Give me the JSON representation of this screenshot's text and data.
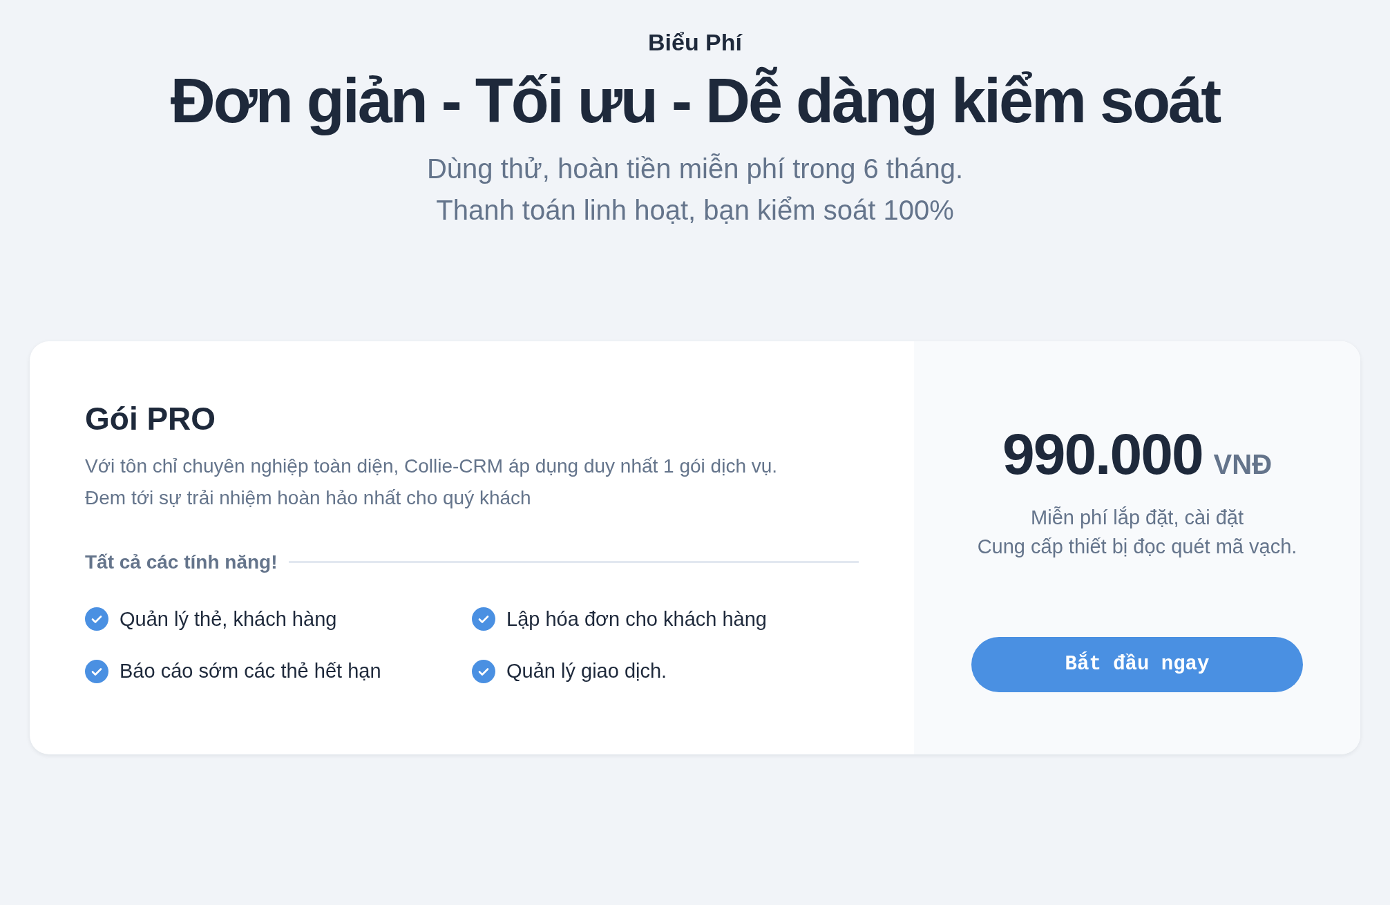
{
  "header": {
    "eyebrow": "Biểu Phí",
    "title": "Đơn giản - Tối ưu - Dễ dàng kiểm soát",
    "subtitle_lines": [
      "Dùng thử, hoàn tiền miễn phí trong 6 tháng.",
      "Thanh toán linh hoạt, bạn kiểm soát 100%"
    ]
  },
  "plan": {
    "name": "Gói PRO",
    "description_lines": [
      "Với tôn chỉ chuyên nghiệp toàn diện, Collie-CRM áp dụng duy nhất 1 gói dịch vụ.",
      "Đem tới sự trải nhiệm hoàn hảo nhất cho quý khách"
    ],
    "features_heading": "Tất cả các tính năng!",
    "features": [
      {
        "label": "Quản lý thẻ, khách hàng",
        "checked": true
      },
      {
        "label": "Lập hóa đơn cho khách hàng",
        "checked": true
      },
      {
        "label": "Báo cáo sớm các thẻ hết hạn",
        "checked": true
      },
      {
        "label": "Quản lý giao dịch.",
        "checked": true
      }
    ]
  },
  "pricing": {
    "amount": "990.000",
    "currency": "VNĐ",
    "notes": [
      "Miễn phí lắp đặt, cài đặt",
      "Cung cấp thiết bị đọc quét mã vạch."
    ],
    "button": "Bắt đầu ngay"
  }
}
